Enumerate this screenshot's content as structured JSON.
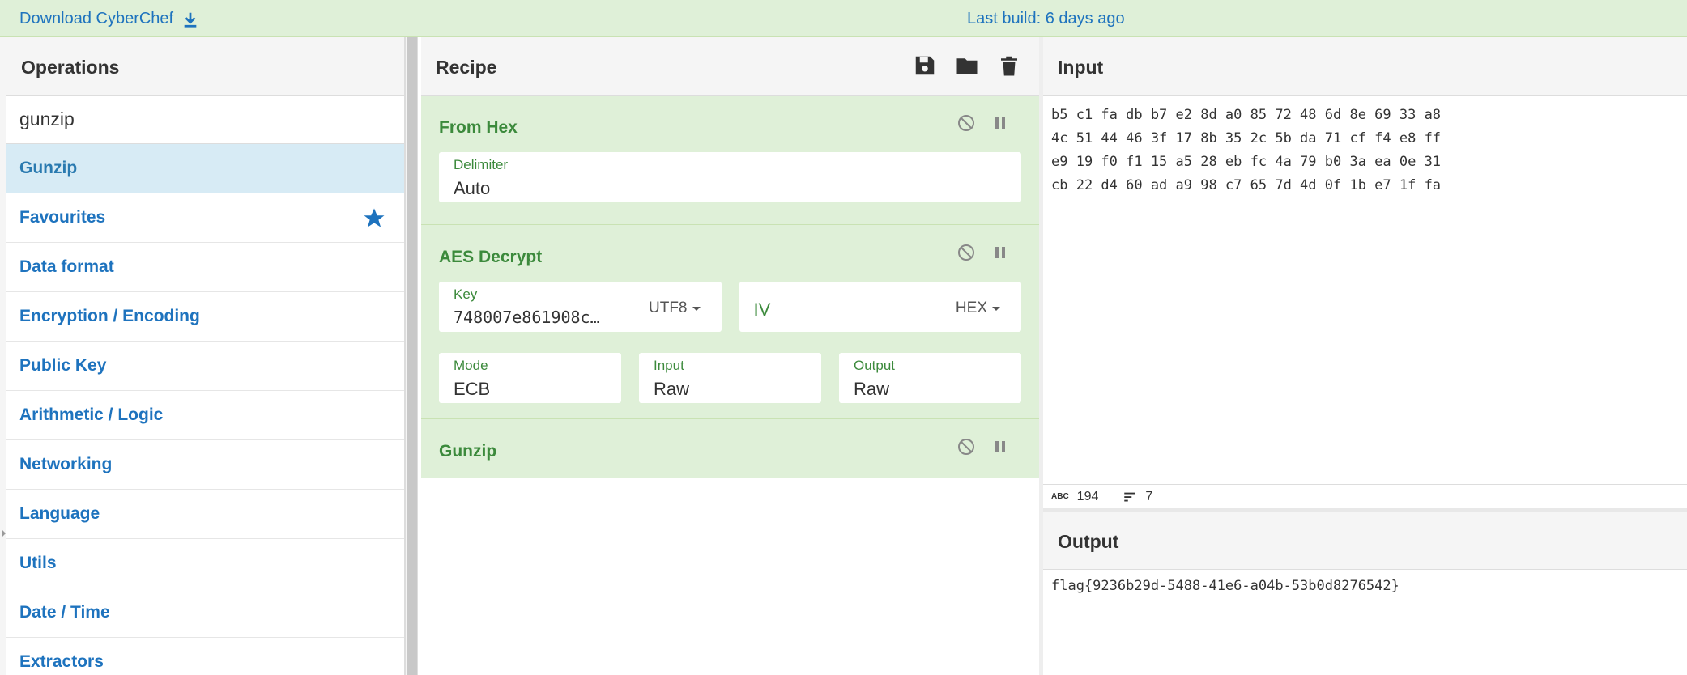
{
  "banner": {
    "download_label": "Download CyberChef",
    "build_label": "Last build: 6 days ago"
  },
  "operations": {
    "title": "Operations",
    "search_value": "gunzip",
    "items": [
      {
        "label": "Gunzip"
      },
      {
        "label": "Favourites"
      },
      {
        "label": "Data format"
      },
      {
        "label": "Encryption / Encoding"
      },
      {
        "label": "Public Key"
      },
      {
        "label": "Arithmetic / Logic"
      },
      {
        "label": "Networking"
      },
      {
        "label": "Language"
      },
      {
        "label": "Utils"
      },
      {
        "label": "Date / Time"
      },
      {
        "label": "Extractors"
      }
    ]
  },
  "recipe": {
    "title": "Recipe",
    "ops": [
      {
        "name": "From Hex",
        "delimiter_label": "Delimiter",
        "delimiter_value": "Auto"
      },
      {
        "name": "AES Decrypt",
        "key_label": "Key",
        "key_value": "748007e861908c…",
        "key_format": "UTF8",
        "iv_placeholder": "IV",
        "iv_format": "HEX",
        "mode_label": "Mode",
        "mode_value": "ECB",
        "input_label": "Input",
        "input_value": "Raw",
        "output_label": "Output",
        "output_value": "Raw"
      },
      {
        "name": "Gunzip"
      }
    ]
  },
  "input": {
    "title": "Input",
    "lines": [
      "b5 c1 fa db b7 e2 8d a0 85 72 48 6d 8e 69 33 a8",
      "4c 51 44 46 3f 17 8b 35 2c 5b da 71 cf f4 e8 ff",
      "e9 19 f0 f1 15 a5 28 eb fc 4a 79 b0 3a ea 0e 31",
      "cb 22 d4 60 ad a9 98 c7 65 7d 4d 0f 1b e7 1f fa"
    ],
    "length": "194",
    "lines_count": "7"
  },
  "output": {
    "title": "Output",
    "text": "flag{9236b29d-5488-41e6-a04b-53b0d8276542}"
  },
  "colors": {
    "banner_bg": "#dff0d8",
    "link": "#1e73be",
    "op_bg": "#dff0d8",
    "op_text": "#3c8a3c",
    "selected_bg": "#d7ebf5"
  }
}
